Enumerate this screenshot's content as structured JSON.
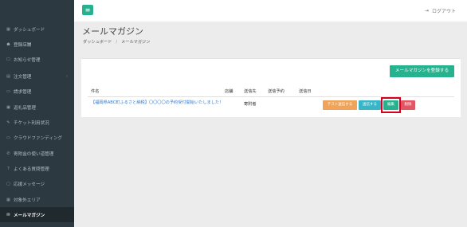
{
  "sidebar": {
    "items": [
      {
        "icon": "▦",
        "label": "ダッシュボード",
        "arrow": ""
      },
      {
        "icon": "☗",
        "label": "登録店舗",
        "arrow": ""
      },
      {
        "icon": "☐",
        "label": "お知らせ管理",
        "arrow": ""
      },
      {
        "icon": "▤",
        "label": "注文管理",
        "arrow": "‹"
      },
      {
        "icon": "▭",
        "label": "請求管理",
        "arrow": ""
      },
      {
        "icon": "▣",
        "label": "返礼品管理",
        "arrow": ""
      },
      {
        "icon": "✎",
        "label": "チケット利用状況",
        "arrow": ""
      },
      {
        "icon": "▭",
        "label": "クラウドファンディング",
        "arrow": ""
      },
      {
        "icon": "✆",
        "label": "寄附金の使い道管理",
        "arrow": ""
      },
      {
        "icon": "?",
        "label": "よくある質問管理",
        "arrow": ""
      },
      {
        "icon": "▢",
        "label": "応援メッセージ",
        "arrow": ""
      },
      {
        "icon": "▦",
        "label": "対象外エリア",
        "arrow": ""
      },
      {
        "icon": "✉",
        "label": "メールマガジン",
        "arrow": ""
      }
    ]
  },
  "topbar": {
    "menu_icon": "≡",
    "logout_icon": "⇥",
    "logout_label": "ログアウト"
  },
  "page": {
    "title": "メールマガジン",
    "breadcrumb": [
      "ダッシュボード",
      "メールマガジン"
    ],
    "breadcrumb_sep": "/"
  },
  "panel": {
    "register_label": "メールマガジンを登録する",
    "columns": [
      "件名",
      "店舗",
      "送信先",
      "送信予約",
      "送信日"
    ],
    "rows": [
      {
        "subject": "【福岡県ABC町ふるさと納税】〇〇〇〇の予約受付開始いたしました！",
        "store": "",
        "destination": "寄附者",
        "scheduled": "",
        "sent": ""
      }
    ],
    "actions": {
      "test": "テスト送信する",
      "send": "送信する",
      "edit": "編集",
      "delete": "削除"
    }
  },
  "colors": {
    "accent": "#26b28f",
    "sidebar_bg": "#2c3940",
    "link": "#2e7bd0",
    "highlight": "#d8001c"
  }
}
